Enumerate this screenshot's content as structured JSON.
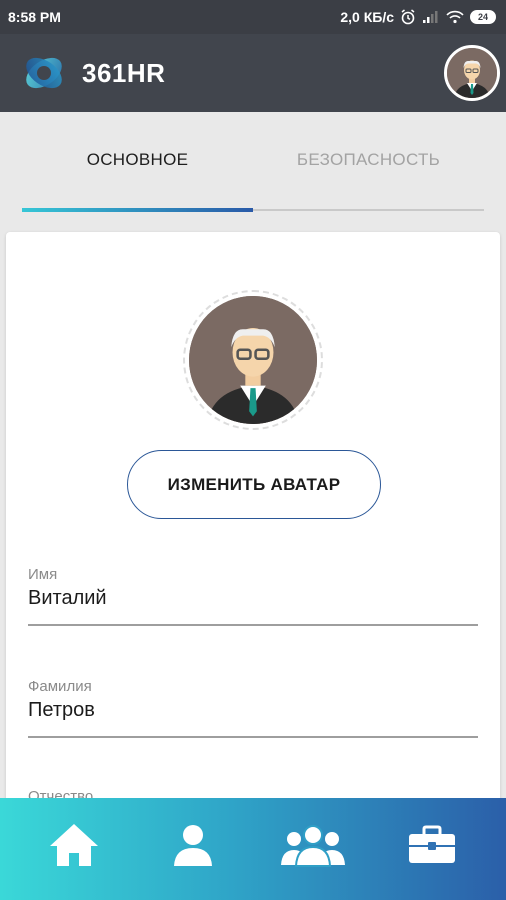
{
  "status_bar": {
    "time": "8:58 PM",
    "network_speed": "2,0 КБ/с",
    "battery": "24",
    "icons": [
      "alarm-icon",
      "signal-icon",
      "wifi-icon",
      "battery-icon"
    ]
  },
  "app_bar": {
    "brand_name": "361HR",
    "logo_icon": "361hr-logo-icon",
    "avatar_icon": "user-avatar-icon"
  },
  "tabs": [
    {
      "label": "ОСНОВНОЕ",
      "active": true
    },
    {
      "label": "БЕЗОПАСНОСТЬ",
      "active": false
    }
  ],
  "profile": {
    "change_avatar_label": "ИЗМЕНИТЬ АВАТАР",
    "fields": [
      {
        "label": "Имя",
        "value": "Виталий"
      },
      {
        "label": "Фамилия",
        "value": "Петров"
      },
      {
        "label": "Отчество",
        "value": ""
      }
    ]
  },
  "bottom_nav": {
    "items": [
      {
        "icon": "home-icon"
      },
      {
        "icon": "profile-icon"
      },
      {
        "icon": "team-icon"
      },
      {
        "icon": "briefcase-icon"
      }
    ]
  },
  "colors": {
    "status_bar": "#3b3e45",
    "app_bar": "#41454d",
    "accent_start": "#36c6d6",
    "accent_end": "#2a5aa8",
    "button_border": "#2b5797"
  }
}
